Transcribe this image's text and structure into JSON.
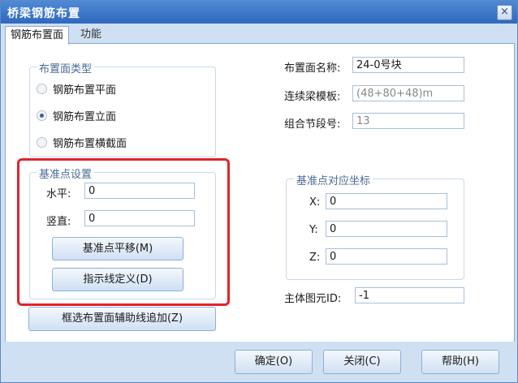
{
  "window": {
    "title": "桥梁钢筋布置",
    "close_glyph": "×"
  },
  "tabs": [
    {
      "label": "钢筋布置面",
      "active": true
    },
    {
      "label": "功能",
      "active": false
    }
  ],
  "plane_type": {
    "legend": "布置面类型",
    "options": [
      {
        "label": "钢筋布置平面",
        "selected": false
      },
      {
        "label": "钢筋布置立面",
        "selected": true
      },
      {
        "label": "钢筋布置横截面",
        "selected": false
      }
    ]
  },
  "info": {
    "name_label": "布置面名称:",
    "name_value": "24-0号块",
    "template_label": "连续梁模板:",
    "template_value": "(48+80+48)m",
    "segment_label": "组合节段号:",
    "segment_value": "13"
  },
  "base_point": {
    "legend": "基准点设置",
    "horizontal_label": "水平:",
    "horizontal_value": "0",
    "vertical_label": "竖直:",
    "vertical_value": "0",
    "move_button": "基准点平移(M)",
    "define_button": "指示线定义(D)"
  },
  "coords": {
    "legend": "基准点对应坐标",
    "x_label": "X:",
    "x_value": "0",
    "y_label": "Y:",
    "y_value": "0",
    "z_label": "Z:",
    "z_value": "0"
  },
  "element": {
    "label": "主体图元ID:",
    "value": "-1"
  },
  "add_guide_button": "框选布置面辅助线追加(Z)",
  "footer": {
    "ok": "确定(O)",
    "close": "关闭(C)",
    "help": "帮助(H)"
  },
  "colors": {
    "title_bar": "#2f68bd",
    "highlight_box": "#e3222a",
    "background": "#cfe0f3"
  }
}
